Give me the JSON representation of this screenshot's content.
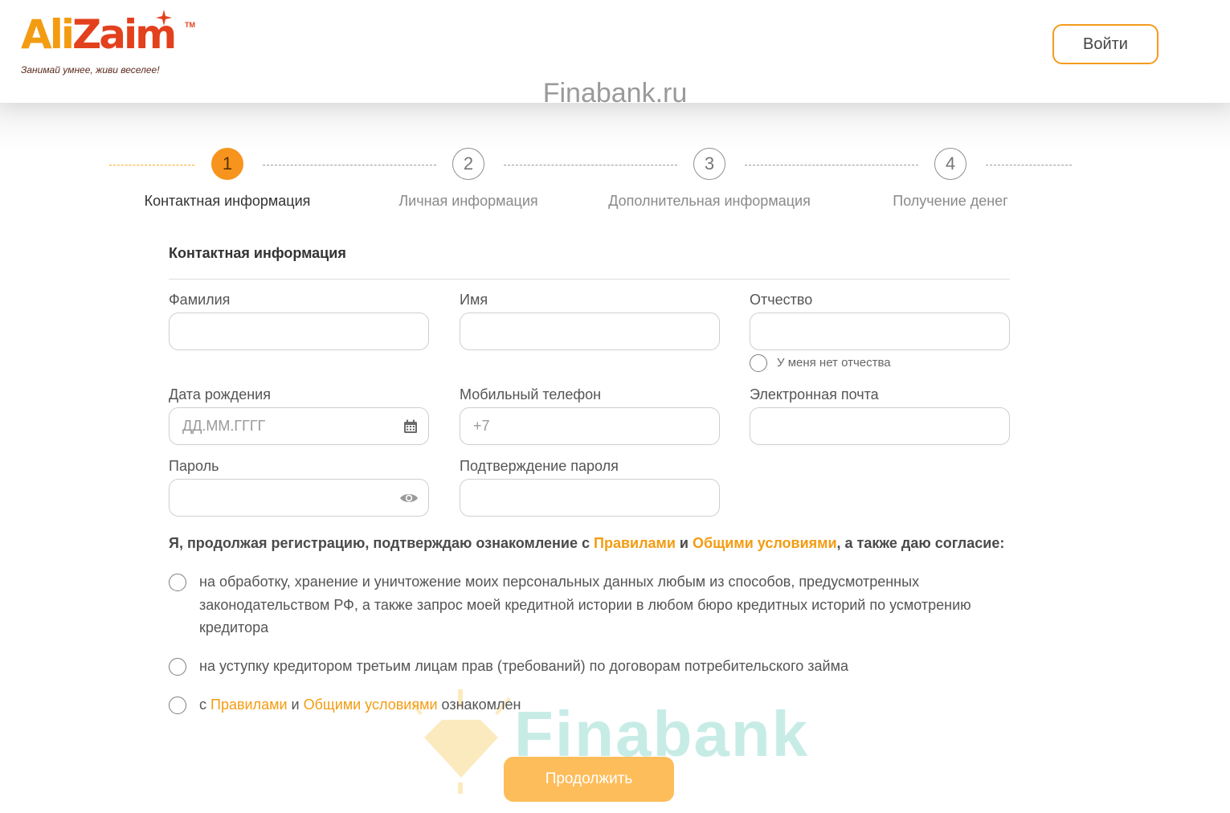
{
  "header": {
    "logo_word_part1": "Ali",
    "logo_word_part2": "Zaim",
    "logo_tm": "TM",
    "slogan": "Занимай умнее, живи веселее!",
    "login_label": "Войти"
  },
  "watermark": {
    "top": "Finabank.ru",
    "bottom": "Finabank"
  },
  "steps": [
    {
      "number": "1",
      "label": "Контактная информация",
      "active": true
    },
    {
      "number": "2",
      "label": "Личная информация",
      "active": false
    },
    {
      "number": "3",
      "label": "Дополнительная информация",
      "active": false
    },
    {
      "number": "4",
      "label": "Получение денег",
      "active": false
    }
  ],
  "form": {
    "section_title": "Контактная информация",
    "fields": {
      "last_name": {
        "label": "Фамилия",
        "value": ""
      },
      "first_name": {
        "label": "Имя",
        "value": ""
      },
      "middle_name": {
        "label": "Отчество",
        "value": ""
      },
      "no_middle_name": "У меня нет отчества",
      "birth_date": {
        "label": "Дата рождения",
        "placeholder": "ДД.ММ.ГГГГ"
      },
      "phone": {
        "label": "Мобильный телефон",
        "placeholder": "+7"
      },
      "email": {
        "label": "Электронная почта",
        "value": ""
      },
      "password": {
        "label": "Пароль",
        "value": ""
      },
      "password_confirm": {
        "label": "Подтверждение пароля",
        "value": ""
      }
    }
  },
  "consent": {
    "title_part1": "Я, продолжая регистрацию, подтверждаю ознакомление с ",
    "rules_link": "Правилами",
    "and": " и ",
    "terms_link": "Общими условиями",
    "title_part2": ", а также даю согласие:",
    "item1": "на обработку, хранение и уничтожение моих персональных данных любым из способов, предусмотренных законодательством РФ, а также запрос моей кредитной истории в любом бюро кредитных историй по усмотрению кредитора",
    "item2": "на уступку кредитором третьим лицам прав (требований) по договорам потребительского займа",
    "item3_prefix": "с ",
    "item3_rules": "Правилами",
    "item3_and": " и ",
    "item3_terms": "Общими условиями",
    "item3_suffix": " ознакомлен"
  },
  "continue_label": "Продолжить",
  "colors": {
    "accent": "#f7941d",
    "button": "#fdbd5b",
    "link": "#f39c12"
  }
}
